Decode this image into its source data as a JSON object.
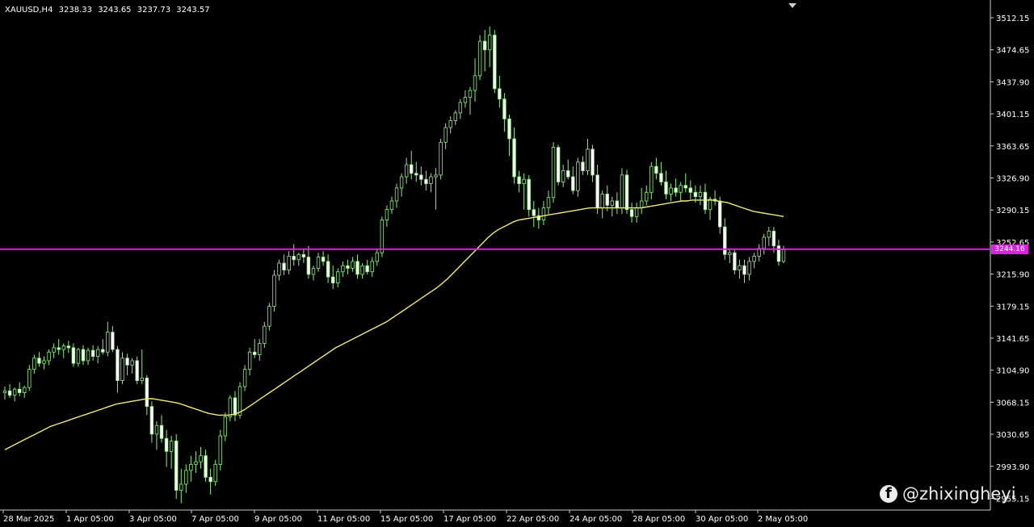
{
  "header": {
    "symbol": "XAUUSD,H4",
    "open": "3238.33",
    "high": "3243.65",
    "low": "3237.73",
    "close": "3243.57"
  },
  "price_axis": {
    "labels": [
      "3512.15",
      "3474.65",
      "3437.90",
      "3401.15",
      "3363.65",
      "3326.90",
      "3290.15",
      "3252.65",
      "3215.90",
      "3179.15",
      "3141.65",
      "3104.90",
      "3068.15",
      "3030.65",
      "2993.90",
      "2955.15"
    ]
  },
  "time_axis": {
    "labels": [
      "28 Mar 2025",
      "1 Apr 05:00",
      "3 Apr 05:00",
      "7 Apr 05:00",
      "9 Apr 05:00",
      "11 Apr 05:00",
      "15 Apr 05:00",
      "17 Apr 05:00",
      "22 Apr 05:00",
      "24 Apr 05:00",
      "28 Apr 05:00",
      "30 Apr 05:00",
      "2 May 05:00"
    ]
  },
  "horizontal_line": {
    "price_label": "3244.16",
    "color": "#e020e0"
  },
  "watermark": {
    "text": "@zhixingheyi",
    "icon": "facebook-icon"
  },
  "colors": {
    "background": "#000000",
    "bull": "#8cf07a",
    "bear": "#ffffff",
    "moving_average": "#f2e87a",
    "hline": "#e020e0"
  },
  "chart_data": {
    "type": "candlestick",
    "title": "XAUUSD,H4",
    "ylim": [
      2955.15,
      3512.15
    ],
    "ohlc": [
      [
        3078,
        3085,
        3070,
        3080
      ],
      [
        3080,
        3088,
        3072,
        3075
      ],
      [
        3075,
        3084,
        3068,
        3082
      ],
      [
        3082,
        3090,
        3074,
        3078
      ],
      [
        3078,
        3086,
        3072,
        3084
      ],
      [
        3084,
        3110,
        3080,
        3105
      ],
      [
        3105,
        3122,
        3100,
        3118
      ],
      [
        3118,
        3125,
        3108,
        3112
      ],
      [
        3112,
        3120,
        3105,
        3115
      ],
      [
        3115,
        3128,
        3110,
        3125
      ],
      [
        3125,
        3135,
        3118,
        3130
      ],
      [
        3130,
        3140,
        3122,
        3128
      ],
      [
        3128,
        3135,
        3118,
        3132
      ],
      [
        3132,
        3138,
        3124,
        3130
      ],
      [
        3130,
        3135,
        3108,
        3112
      ],
      [
        3112,
        3130,
        3108,
        3128
      ],
      [
        3128,
        3133,
        3110,
        3115
      ],
      [
        3115,
        3130,
        3110,
        3127
      ],
      [
        3127,
        3133,
        3115,
        3120
      ],
      [
        3120,
        3132,
        3112,
        3128
      ],
      [
        3128,
        3140,
        3122,
        3125
      ],
      [
        3125,
        3160,
        3120,
        3148
      ],
      [
        3148,
        3155,
        3125,
        3128
      ],
      [
        3128,
        3132,
        3078,
        3092
      ],
      [
        3092,
        3125,
        3088,
        3118
      ],
      [
        3118,
        3123,
        3098,
        3110
      ],
      [
        3110,
        3118,
        3100,
        3115
      ],
      [
        3115,
        3120,
        3088,
        3092
      ],
      [
        3092,
        3128,
        3088,
        3095
      ],
      [
        3095,
        3098,
        3052,
        3062
      ],
      [
        3062,
        3068,
        3020,
        3030
      ],
      [
        3030,
        3045,
        3012,
        3040
      ],
      [
        3040,
        3052,
        3020,
        3025
      ],
      [
        3025,
        3035,
        2992,
        3010
      ],
      [
        3010,
        3028,
        2990,
        3022
      ],
      [
        3022,
        3030,
        2955,
        2965
      ],
      [
        2965,
        2990,
        2950,
        2972
      ],
      [
        2972,
        2995,
        2962,
        2988
      ],
      [
        2988,
        3005,
        2975,
        2995
      ],
      [
        2995,
        3010,
        2985,
        2998
      ],
      [
        2998,
        3015,
        2990,
        3005
      ],
      [
        3005,
        3012,
        2975,
        2980
      ],
      [
        2980,
        2990,
        2960,
        2975
      ],
      [
        2975,
        3000,
        2970,
        2995
      ],
      [
        2995,
        3035,
        2988,
        3028
      ],
      [
        3028,
        3055,
        3022,
        3050
      ],
      [
        3050,
        3075,
        3045,
        3072
      ],
      [
        3072,
        3080,
        3045,
        3052
      ],
      [
        3052,
        3090,
        3048,
        3085
      ],
      [
        3085,
        3110,
        3080,
        3105
      ],
      [
        3105,
        3130,
        3098,
        3125
      ],
      [
        3125,
        3140,
        3118,
        3122
      ],
      [
        3122,
        3140,
        3115,
        3135
      ],
      [
        3135,
        3160,
        3130,
        3155
      ],
      [
        3155,
        3182,
        3150,
        3178
      ],
      [
        3178,
        3220,
        3172,
        3214
      ],
      [
        3214,
        3232,
        3208,
        3228
      ],
      [
        3228,
        3238,
        3214,
        3220
      ],
      [
        3220,
        3242,
        3215,
        3236
      ],
      [
        3236,
        3250,
        3225,
        3232
      ],
      [
        3232,
        3240,
        3225,
        3238
      ],
      [
        3238,
        3245,
        3228,
        3235
      ],
      [
        3235,
        3248,
        3210,
        3215
      ],
      [
        3215,
        3225,
        3208,
        3222
      ],
      [
        3222,
        3240,
        3218,
        3235
      ],
      [
        3235,
        3242,
        3225,
        3230
      ],
      [
        3230,
        3238,
        3205,
        3212
      ],
      [
        3212,
        3225,
        3198,
        3205
      ],
      [
        3205,
        3222,
        3200,
        3218
      ],
      [
        3218,
        3230,
        3212,
        3225
      ],
      [
        3225,
        3232,
        3215,
        3222
      ],
      [
        3222,
        3235,
        3218,
        3230
      ],
      [
        3230,
        3238,
        3210,
        3215
      ],
      [
        3215,
        3228,
        3210,
        3225
      ],
      [
        3225,
        3232,
        3215,
        3218
      ],
      [
        3218,
        3235,
        3212,
        3230
      ],
      [
        3230,
        3245,
        3225,
        3240
      ],
      [
        3240,
        3282,
        3235,
        3278
      ],
      [
        3278,
        3295,
        3270,
        3290
      ],
      [
        3290,
        3305,
        3285,
        3300
      ],
      [
        3300,
        3320,
        3292,
        3315
      ],
      [
        3315,
        3332,
        3305,
        3328
      ],
      [
        3328,
        3350,
        3320,
        3342
      ],
      [
        3342,
        3358,
        3325,
        3332
      ],
      [
        3332,
        3345,
        3322,
        3330
      ],
      [
        3330,
        3340,
        3318,
        3325
      ],
      [
        3325,
        3335,
        3312,
        3320
      ],
      [
        3320,
        3332,
        3310,
        3328
      ],
      [
        3328,
        3338,
        3290,
        3330
      ],
      [
        3330,
        3372,
        3325,
        3368
      ],
      [
        3368,
        3390,
        3360,
        3385
      ],
      [
        3385,
        3398,
        3378,
        3393
      ],
      [
        3393,
        3405,
        3388,
        3402
      ],
      [
        3402,
        3418,
        3395,
        3414
      ],
      [
        3414,
        3428,
        3408,
        3420
      ],
      [
        3420,
        3432,
        3400,
        3428
      ],
      [
        3428,
        3465,
        3415,
        3445
      ],
      [
        3445,
        3492,
        3440,
        3485
      ],
      [
        3485,
        3498,
        3450,
        3475
      ],
      [
        3475,
        3502,
        3455,
        3492
      ],
      [
        3492,
        3498,
        3425,
        3430
      ],
      [
        3430,
        3445,
        3408,
        3418
      ],
      [
        3418,
        3425,
        3380,
        3395
      ],
      [
        3395,
        3400,
        3352,
        3372
      ],
      [
        3372,
        3385,
        3320,
        3328
      ],
      [
        3328,
        3335,
        3310,
        3320
      ],
      [
        3320,
        3332,
        3290,
        3325
      ],
      [
        3325,
        3330,
        3282,
        3290
      ],
      [
        3290,
        3300,
        3270,
        3283
      ],
      [
        3283,
        3292,
        3268,
        3278
      ],
      [
        3278,
        3300,
        3272,
        3292
      ],
      [
        3292,
        3312,
        3285,
        3304
      ],
      [
        3304,
        3368,
        3298,
        3362
      ],
      [
        3362,
        3365,
        3318,
        3322
      ],
      [
        3322,
        3342,
        3316,
        3335
      ],
      [
        3335,
        3348,
        3325,
        3328
      ],
      [
        3328,
        3340,
        3308,
        3312
      ],
      [
        3312,
        3350,
        3305,
        3345
      ],
      [
        3345,
        3352,
        3330,
        3335
      ],
      [
        3335,
        3372,
        3330,
        3360
      ],
      [
        3360,
        3365,
        3322,
        3330
      ],
      [
        3330,
        3342,
        3285,
        3292
      ],
      [
        3292,
        3312,
        3280,
        3308
      ],
      [
        3308,
        3318,
        3288,
        3295
      ],
      [
        3295,
        3305,
        3282,
        3300
      ],
      [
        3300,
        3310,
        3285,
        3292
      ],
      [
        3292,
        3338,
        3285,
        3330
      ],
      [
        3330,
        3336,
        3285,
        3290
      ],
      [
        3290,
        3298,
        3275,
        3282
      ],
      [
        3282,
        3298,
        3275,
        3292
      ],
      [
        3292,
        3315,
        3285,
        3300
      ],
      [
        3300,
        3318,
        3295,
        3310
      ],
      [
        3310,
        3345,
        3302,
        3340
      ],
      [
        3340,
        3350,
        3325,
        3332
      ],
      [
        3332,
        3345,
        3318,
        3322
      ],
      [
        3322,
        3335,
        3302,
        3308
      ],
      [
        3308,
        3320,
        3300,
        3315
      ],
      [
        3315,
        3326,
        3305,
        3310
      ],
      [
        3310,
        3322,
        3300,
        3318
      ],
      [
        3318,
        3332,
        3310,
        3315
      ],
      [
        3315,
        3324,
        3302,
        3310
      ],
      [
        3310,
        3318,
        3298,
        3305
      ],
      [
        3305,
        3318,
        3295,
        3310
      ],
      [
        3310,
        3320,
        3285,
        3290
      ],
      [
        3290,
        3305,
        3278,
        3302
      ],
      [
        3302,
        3312,
        3295,
        3300
      ],
      [
        3300,
        3305,
        3262,
        3270
      ],
      [
        3270,
        3280,
        3232,
        3238
      ],
      [
        3238,
        3245,
        3228,
        3240
      ],
      [
        3240,
        3245,
        3215,
        3220
      ],
      [
        3220,
        3232,
        3210,
        3225
      ],
      [
        3225,
        3232,
        3205,
        3215
      ],
      [
        3215,
        3235,
        3208,
        3230
      ],
      [
        3230,
        3240,
        3222,
        3236
      ],
      [
        3236,
        3250,
        3230,
        3245
      ],
      [
        3245,
        3262,
        3238,
        3258
      ],
      [
        3258,
        3270,
        3248,
        3265
      ],
      [
        3265,
        3270,
        3240,
        3248
      ],
      [
        3248,
        3255,
        3225,
        3230
      ],
      [
        3230,
        3248,
        3228,
        3243.57
      ]
    ],
    "moving_average": [
      3012,
      3015,
      3018,
      3021,
      3024,
      3027,
      3030,
      3033,
      3036,
      3039,
      3041,
      3043,
      3045,
      3047,
      3049,
      3051,
      3053,
      3055,
      3057,
      3059,
      3061,
      3063,
      3065,
      3066,
      3067,
      3068,
      3069,
      3070,
      3071,
      3071,
      3070,
      3069,
      3068,
      3067,
      3066,
      3064,
      3062,
      3060,
      3058,
      3056,
      3054,
      3053,
      3052,
      3052,
      3052,
      3053,
      3055,
      3058,
      3062,
      3066,
      3070,
      3074,
      3078,
      3082,
      3086,
      3090,
      3094,
      3098,
      3102,
      3106,
      3110,
      3114,
      3118,
      3122,
      3126,
      3130,
      3133,
      3136,
      3139,
      3142,
      3145,
      3148,
      3151,
      3154,
      3157,
      3160,
      3164,
      3168,
      3172,
      3176,
      3180,
      3184,
      3188,
      3192,
      3196,
      3200,
      3205,
      3210,
      3216,
      3222,
      3228,
      3234,
      3240,
      3246,
      3252,
      3258,
      3263,
      3267,
      3270,
      3273,
      3276,
      3278,
      3279,
      3280,
      3281,
      3282,
      3283,
      3284,
      3285,
      3286,
      3287,
      3288,
      3289,
      3290,
      3291,
      3292,
      3292,
      3292,
      3292,
      3292,
      3292,
      3292,
      3292,
      3292,
      3292,
      3292,
      3293,
      3294,
      3295,
      3296,
      3297,
      3298,
      3299,
      3300,
      3300,
      3301,
      3301,
      3301,
      3301,
      3301,
      3300,
      3299,
      3298,
      3296,
      3294,
      3292,
      3290,
      3288,
      3287,
      3286,
      3285,
      3284,
      3283,
      3282
    ]
  }
}
